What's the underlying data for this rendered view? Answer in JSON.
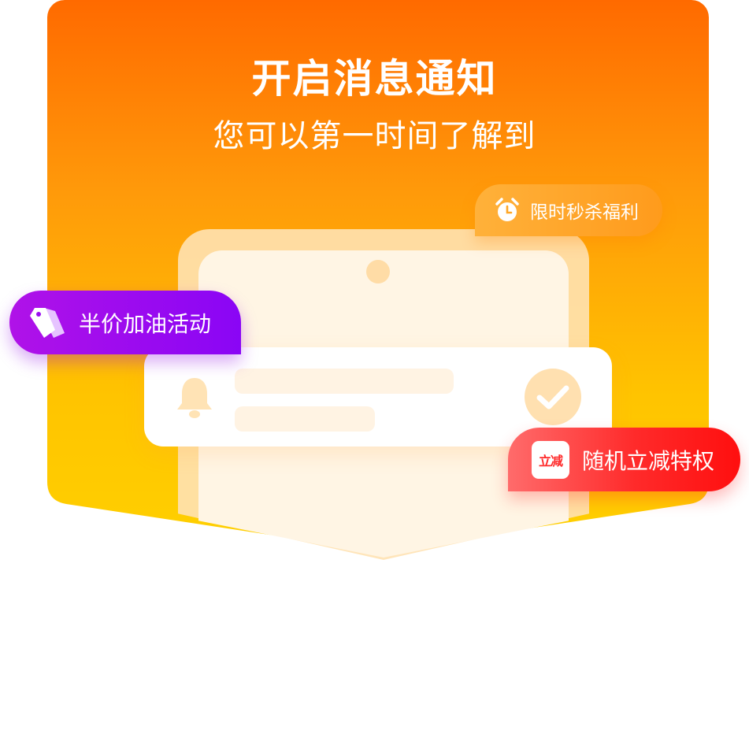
{
  "header": {
    "title": "开启消息通知",
    "subtitle": "您可以第一时间了解到"
  },
  "tags": {
    "limited_offer": {
      "label": "限时秒杀福利",
      "icon": "alarm-clock-icon"
    },
    "half_price": {
      "label": "半价加油活动",
      "icon": "price-tag-icon"
    },
    "random_discount": {
      "label": "随机立减特权",
      "badge": "立减"
    }
  },
  "notification": {
    "bell_icon": "bell-icon",
    "check_icon": "check-circle-icon"
  },
  "colors": {
    "banner_top": "#ff6a00",
    "banner_bottom": "#ffd000",
    "purple_tag": "#8a05f5",
    "red_tag": "#ff1a1a",
    "orange_tag": "#ff9b1c"
  }
}
